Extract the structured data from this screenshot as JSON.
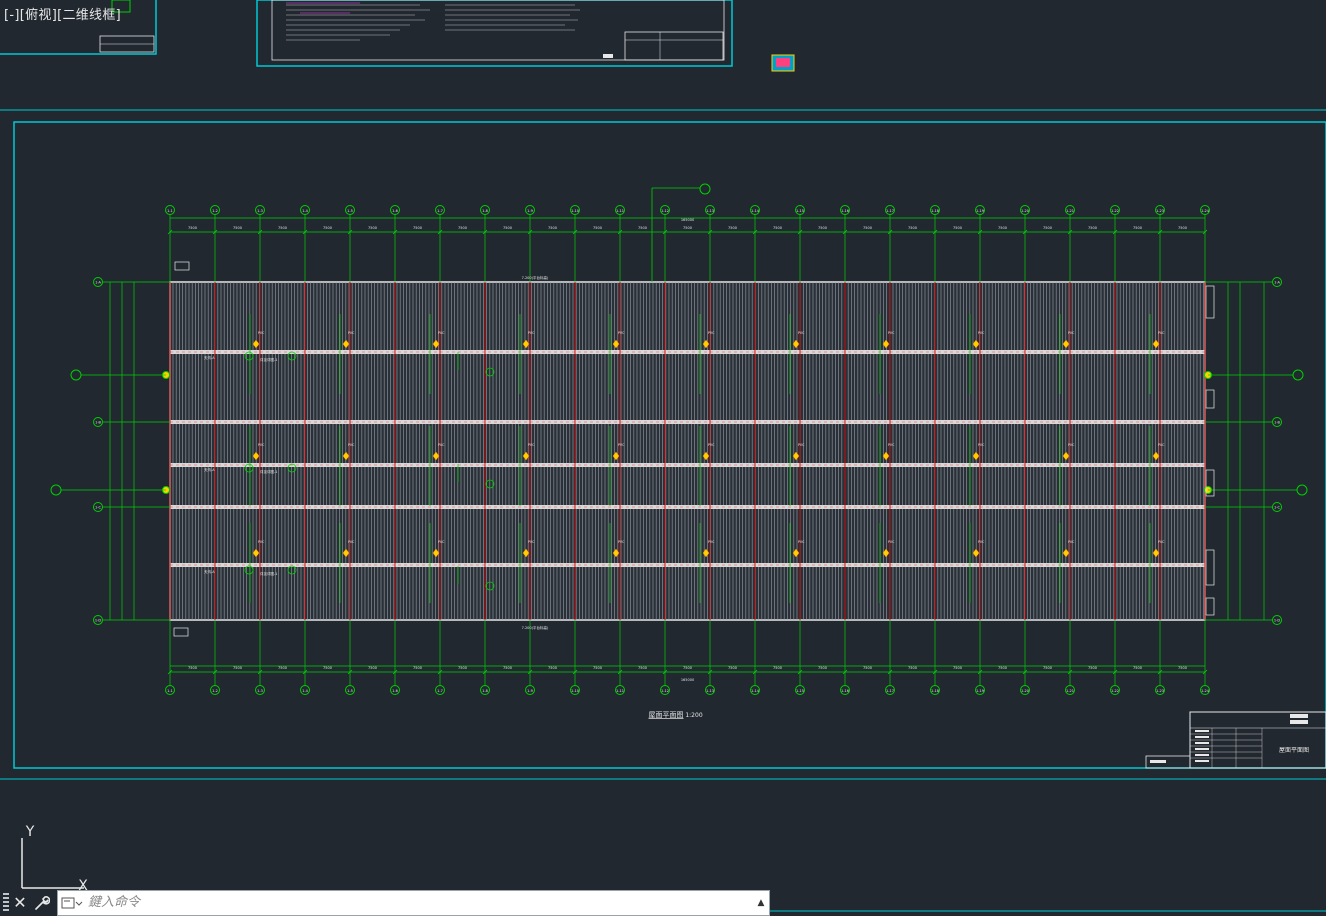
{
  "viewport": {
    "label": "[-][俯视][二维线框]"
  },
  "colors": {
    "background": "#212830",
    "frame": "#00c8d2",
    "axis_grid": "#00d000",
    "column_line": "#d00000",
    "roof_panel": "#e8e8e8",
    "highlight": "#ffd000"
  },
  "drawing": {
    "title": "屋面平面图",
    "scale": "1:200",
    "title_block_name": "屋面平面图",
    "grid_columns_top": [
      "1-1",
      "1-2",
      "1-3",
      "1-4",
      "1-5",
      "1-6",
      "1-7",
      "1-8",
      "1-9",
      "1-10",
      "1-11",
      "1-12",
      "1-13",
      "1-14",
      "1-15",
      "1-16",
      "1-17",
      "1-18",
      "1-19",
      "1-20",
      "1-21",
      "1-22",
      "1-23",
      "1-24"
    ],
    "grid_rows": [
      "1-A",
      "1-B",
      "1-C",
      "1-D",
      "1-E"
    ],
    "bay_spacing_label": "7500",
    "total_length_label": "165000",
    "elevation_top": "7.200(平台标高)",
    "elevation_bottom": "7.200(平台标高)",
    "gutter_note": "天沟-A",
    "gutter_detail_note": "详见详图-1",
    "downpipe_label": "PVC"
  },
  "command": {
    "placeholder": "鍵入命令",
    "close_icon": "close-icon",
    "customize_icon": "wrench-icon",
    "history_icon": "chevron-up-icon"
  },
  "ucs": {
    "y_label": "Y",
    "x_label": "X"
  }
}
